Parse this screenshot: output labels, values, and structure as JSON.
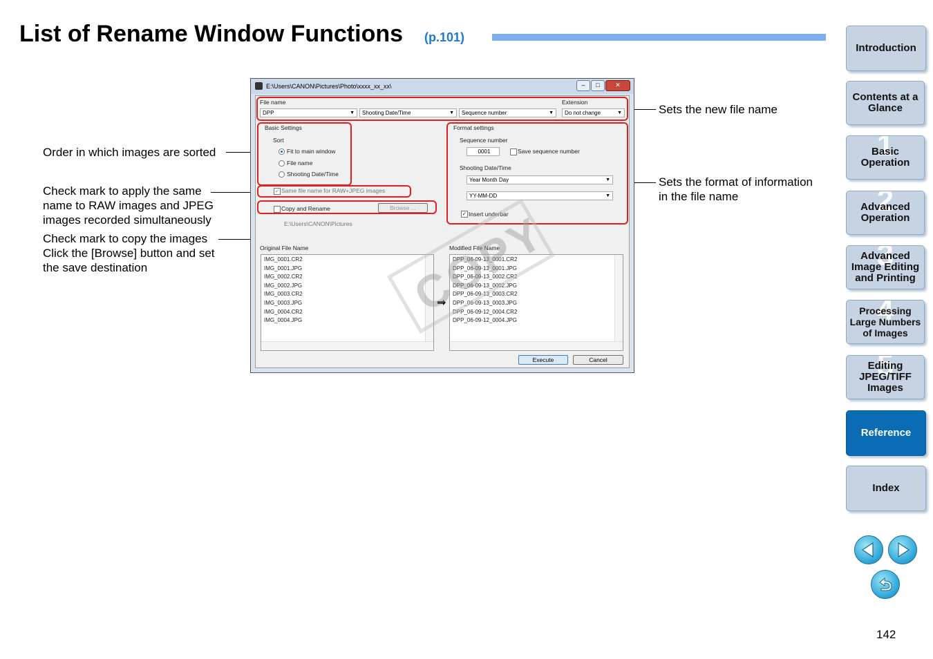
{
  "title": {
    "text": "List of Rename Window Functions",
    "ref": "(p.101)"
  },
  "sidebar": {
    "items": [
      {
        "label": "Introduction",
        "num": ""
      },
      {
        "label": "Contents at a Glance",
        "num": ""
      },
      {
        "label": "Basic Operation",
        "num": "1"
      },
      {
        "label": "Advanced Operation",
        "num": "2"
      },
      {
        "label": "Advanced Image Editing and Printing",
        "num": "3"
      },
      {
        "label": "Processing Large Numbers of Images",
        "num": "4"
      },
      {
        "label": "Editing JPEG/TIFF Images",
        "num": "5"
      },
      {
        "label": "Reference",
        "num": ""
      },
      {
        "label": "Index",
        "num": ""
      }
    ],
    "active": "Reference"
  },
  "annotations": {
    "order": "Order in which images are sorted",
    "same_name": "Check mark to apply the same name to RAW images and JPEG images recorded simultaneously",
    "copy": "Check mark to copy the images Click the [Browse] button and set the save destination",
    "new_name": "Sets the new file name",
    "format": "Sets the format of information in the file name"
  },
  "window": {
    "title": "E:\\Users\\CANON\\Pictures\\Photo\\xxxx_xx_xx\\",
    "file_name_label": "File name",
    "extension_label": "Extension",
    "combo1": "DPP",
    "combo2": "Shooting Date/Time",
    "combo3": "Sequence number",
    "extension_value": "Do not change",
    "basic_settings": "Basic Settings",
    "sort_label": "Sort",
    "sort_options": [
      "Fit to main window",
      "File name",
      "Shooting Date/Time"
    ],
    "same_file_name": "Same file name for RAW+JPEG images",
    "copy_rename": "Copy and Rename",
    "browse": "Browse ...",
    "dest_path": "E:\\Users\\CANON\\Pictures",
    "format_settings": "Format settings",
    "sequence_number_label": "Sequence number",
    "sequence_value": "0001",
    "save_sequence": "Save sequence number",
    "shooting_dt_label": "Shooting Date/Time",
    "date_order": "Year Month Day",
    "date_format": "YY-MM-DD",
    "insert_underbar": "Insert underbar",
    "original_label": "Original File Name",
    "modified_label": "Modified File Name",
    "original_files": [
      "IMG_0001.CR2",
      "IMG_0001.JPG",
      "IMG_0002.CR2",
      "IMG_0002.JPG",
      "IMG_0003.CR2",
      "IMG_0003.JPG",
      "IMG_0004.CR2",
      "IMG_0004.JPG"
    ],
    "modified_files": [
      "DPP_06-09-13_0001.CR2",
      "DPP_06-09-13_0001.JPG",
      "DPP_06-09-13_0002.CR2",
      "DPP_06-09-13_0002.JPG",
      "DPP_06-09-13_0003.CR2",
      "DPP_06-09-13_0003.JPG",
      "DPP_06-09-12_0004.CR2",
      "DPP_06-09-12_0004.JPG"
    ],
    "execute": "Execute",
    "cancel": "Cancel"
  },
  "watermark": "COPY",
  "page_number": "142",
  "colors": {
    "accent_blue": "#1e78d0",
    "title_bar": "#7aaef0",
    "nav_button": "#c6d3e2",
    "nav_active": "#0a6cb4",
    "highlight_red": "#e02020"
  }
}
